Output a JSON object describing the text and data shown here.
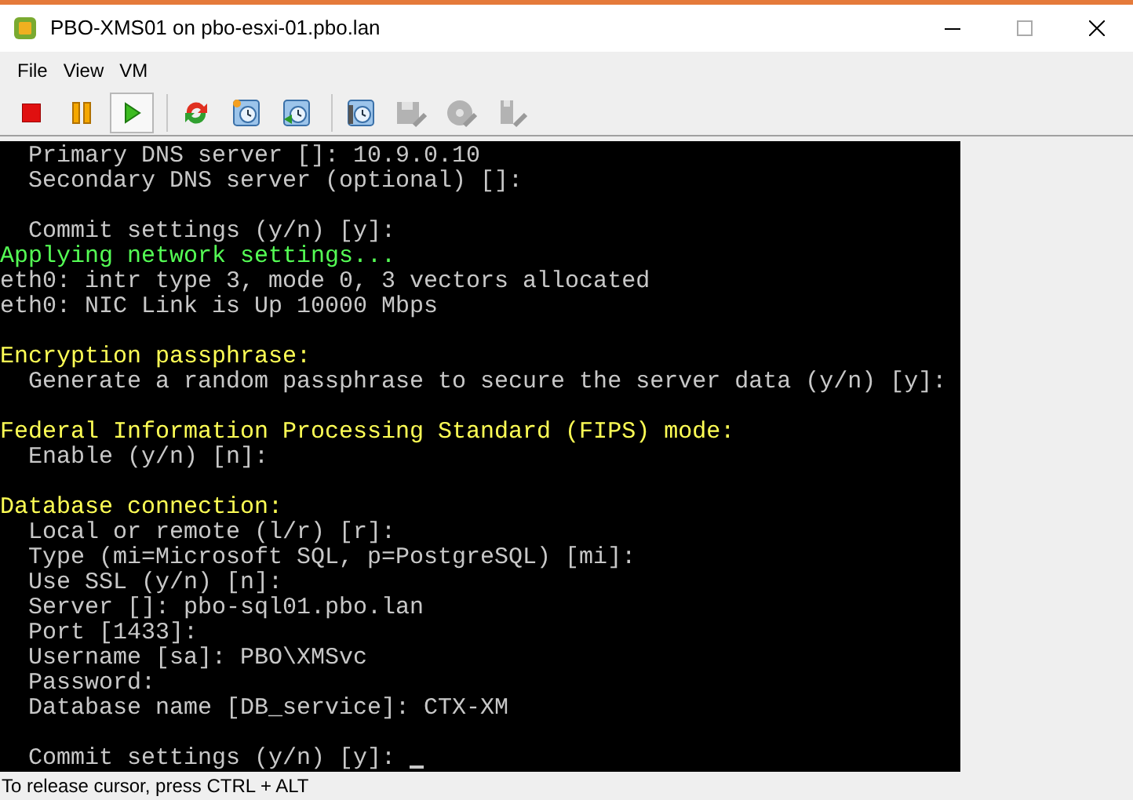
{
  "window": {
    "title": "PBO-XMS01 on pbo-esxi-01.pbo.lan"
  },
  "menu": [
    "File",
    "View",
    "VM"
  ],
  "toolbar": [
    {
      "kind": "stop",
      "selected": false,
      "disabled": false
    },
    {
      "kind": "pause",
      "selected": false,
      "disabled": false
    },
    {
      "kind": "play",
      "selected": true,
      "disabled": false
    },
    {
      "kind": "reset",
      "selected": false,
      "disabled": false
    },
    {
      "kind": "snapshot",
      "selected": false,
      "disabled": false
    },
    {
      "kind": "revert",
      "selected": false,
      "disabled": false
    },
    {
      "kind": "manage",
      "selected": false,
      "disabled": false
    },
    {
      "kind": "floppy",
      "selected": false,
      "disabled": true
    },
    {
      "kind": "cd",
      "selected": false,
      "disabled": true
    },
    {
      "kind": "usb",
      "selected": false,
      "disabled": true
    }
  ],
  "console": [
    {
      "kind": "text",
      "text": "  Primary DNS server []: 10.9.0.10"
    },
    {
      "kind": "text",
      "text": "  Secondary DNS server (optional) []:"
    },
    {
      "kind": "blank"
    },
    {
      "kind": "text",
      "text": "  Commit settings (y/n) [y]:"
    },
    {
      "kind": "status",
      "text": "Applying network settings..."
    },
    {
      "kind": "text",
      "text": "eth0: intr type 3, mode 0, 3 vectors allocated"
    },
    {
      "kind": "text",
      "text": "eth0: NIC Link is Up 10000 Mbps"
    },
    {
      "kind": "blank"
    },
    {
      "kind": "heading",
      "text": "Encryption passphrase:"
    },
    {
      "kind": "text",
      "text": "  Generate a random passphrase to secure the server data (y/n) [y]:"
    },
    {
      "kind": "blank"
    },
    {
      "kind": "heading",
      "text": "Federal Information Processing Standard (FIPS) mode:"
    },
    {
      "kind": "text",
      "text": "  Enable (y/n) [n]:"
    },
    {
      "kind": "blank"
    },
    {
      "kind": "heading",
      "text": "Database connection:"
    },
    {
      "kind": "text",
      "text": "  Local or remote (l/r) [r]:"
    },
    {
      "kind": "text",
      "text": "  Type (mi=Microsoft SQL, p=PostgreSQL) [mi]:"
    },
    {
      "kind": "text",
      "text": "  Use SSL (y/n) [n]:"
    },
    {
      "kind": "text",
      "text": "  Server []: pbo-sql01.pbo.lan"
    },
    {
      "kind": "text",
      "text": "  Port [1433]:"
    },
    {
      "kind": "text",
      "text": "  Username [sa]: PBO\\XMSvc"
    },
    {
      "kind": "text",
      "text": "  Password:"
    },
    {
      "kind": "text",
      "text": "  Database name [DB_service]: CTX-XM"
    },
    {
      "kind": "blank"
    },
    {
      "kind": "text",
      "text": "  Commit settings (y/n) [y]: ",
      "cursor": true
    }
  ],
  "status_bar": "To release cursor, press CTRL + ALT"
}
